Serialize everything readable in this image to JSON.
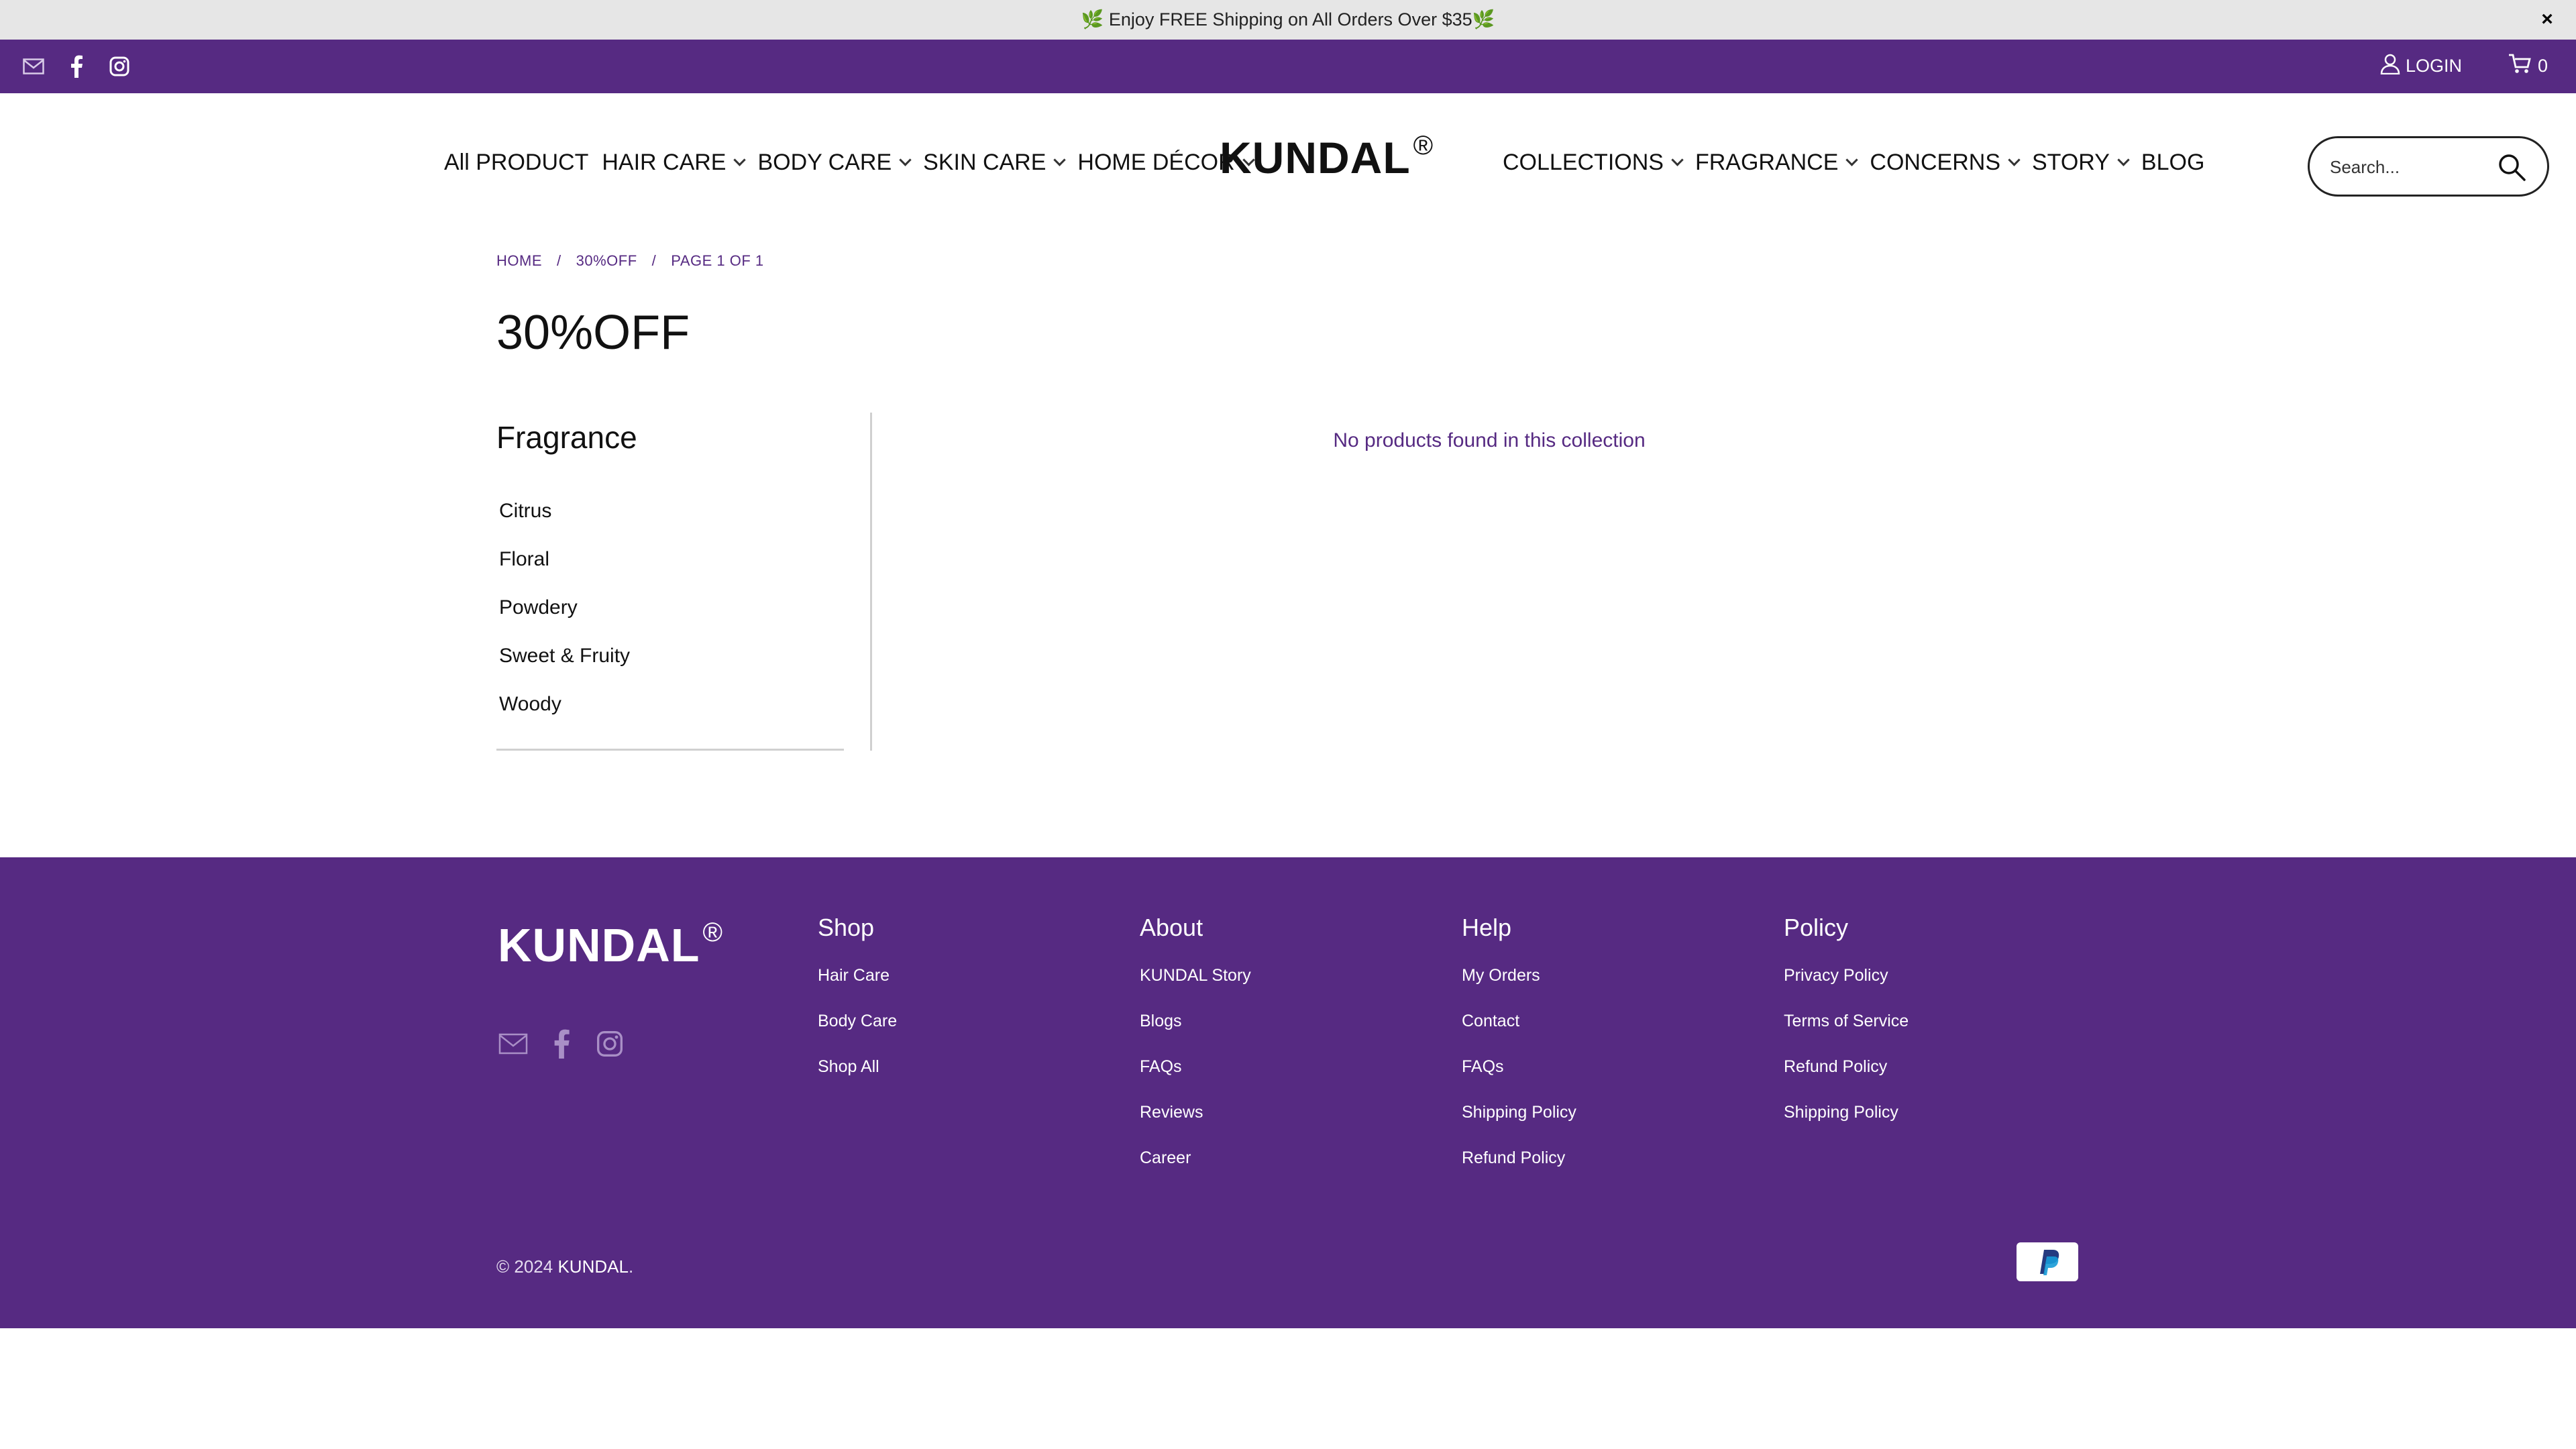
{
  "announcement": {
    "text": "🌿 Enjoy FREE Shipping on All Orders Over $35🌿",
    "close_label": "×"
  },
  "utility_bar": {
    "social_icons": [
      "mail-icon",
      "facebook-icon",
      "instagram-icon"
    ],
    "login_label": "LOGIN",
    "cart_count": "0"
  },
  "header": {
    "logo_text": "KUNDAL",
    "logo_mark": "®",
    "nav_left": [
      {
        "label": "All PRODUCT",
        "has_dropdown": false
      },
      {
        "label": "HAIR CARE",
        "has_dropdown": true
      },
      {
        "label": "BODY CARE",
        "has_dropdown": true
      },
      {
        "label": "SKIN CARE",
        "has_dropdown": true
      },
      {
        "label": "HOME DÉCOR",
        "has_dropdown": true
      }
    ],
    "nav_right": [
      {
        "label": "COLLECTIONS",
        "has_dropdown": true
      },
      {
        "label": "FRAGRANCE",
        "has_dropdown": true
      },
      {
        "label": "CONCERNS",
        "has_dropdown": true
      },
      {
        "label": "STORY",
        "has_dropdown": true
      },
      {
        "label": "BLOG",
        "has_dropdown": false
      }
    ],
    "search_placeholder": "Search..."
  },
  "breadcrumb": {
    "home": "HOME",
    "collection": "30%OFF",
    "page": "PAGE 1 OF 1",
    "separator": "/"
  },
  "page_title": "30%OFF",
  "sidebar": {
    "title": "Fragrance",
    "items": [
      "Citrus",
      "Floral",
      "Powdery",
      "Sweet & Fruity",
      "Woody"
    ]
  },
  "main": {
    "empty_message": "No products found in this collection"
  },
  "footer": {
    "logo_text": "KUNDAL",
    "logo_mark": "®",
    "columns": [
      {
        "title": "Shop",
        "links": [
          "Hair Care",
          "Body Care",
          "Shop All"
        ]
      },
      {
        "title": "About",
        "links": [
          "KUNDAL Story",
          "Blogs",
          "FAQs",
          "Reviews",
          "Career"
        ]
      },
      {
        "title": "Help",
        "links": [
          "My Orders",
          "Contact",
          "FAQs",
          "Shipping Policy",
          "Refund Policy"
        ]
      },
      {
        "title": "Policy",
        "links": [
          "Privacy Policy",
          "Terms of Service",
          "Refund Policy",
          "Shipping Policy"
        ]
      }
    ],
    "copyright_prefix": "© 2024",
    "copyright_brand": "KUNDAL",
    "copyright_suffix": ".",
    "payment_icon": "paypal-icon"
  },
  "colors": {
    "brand_purple": "#562a82",
    "announcement_bg": "#e6e6e6"
  }
}
